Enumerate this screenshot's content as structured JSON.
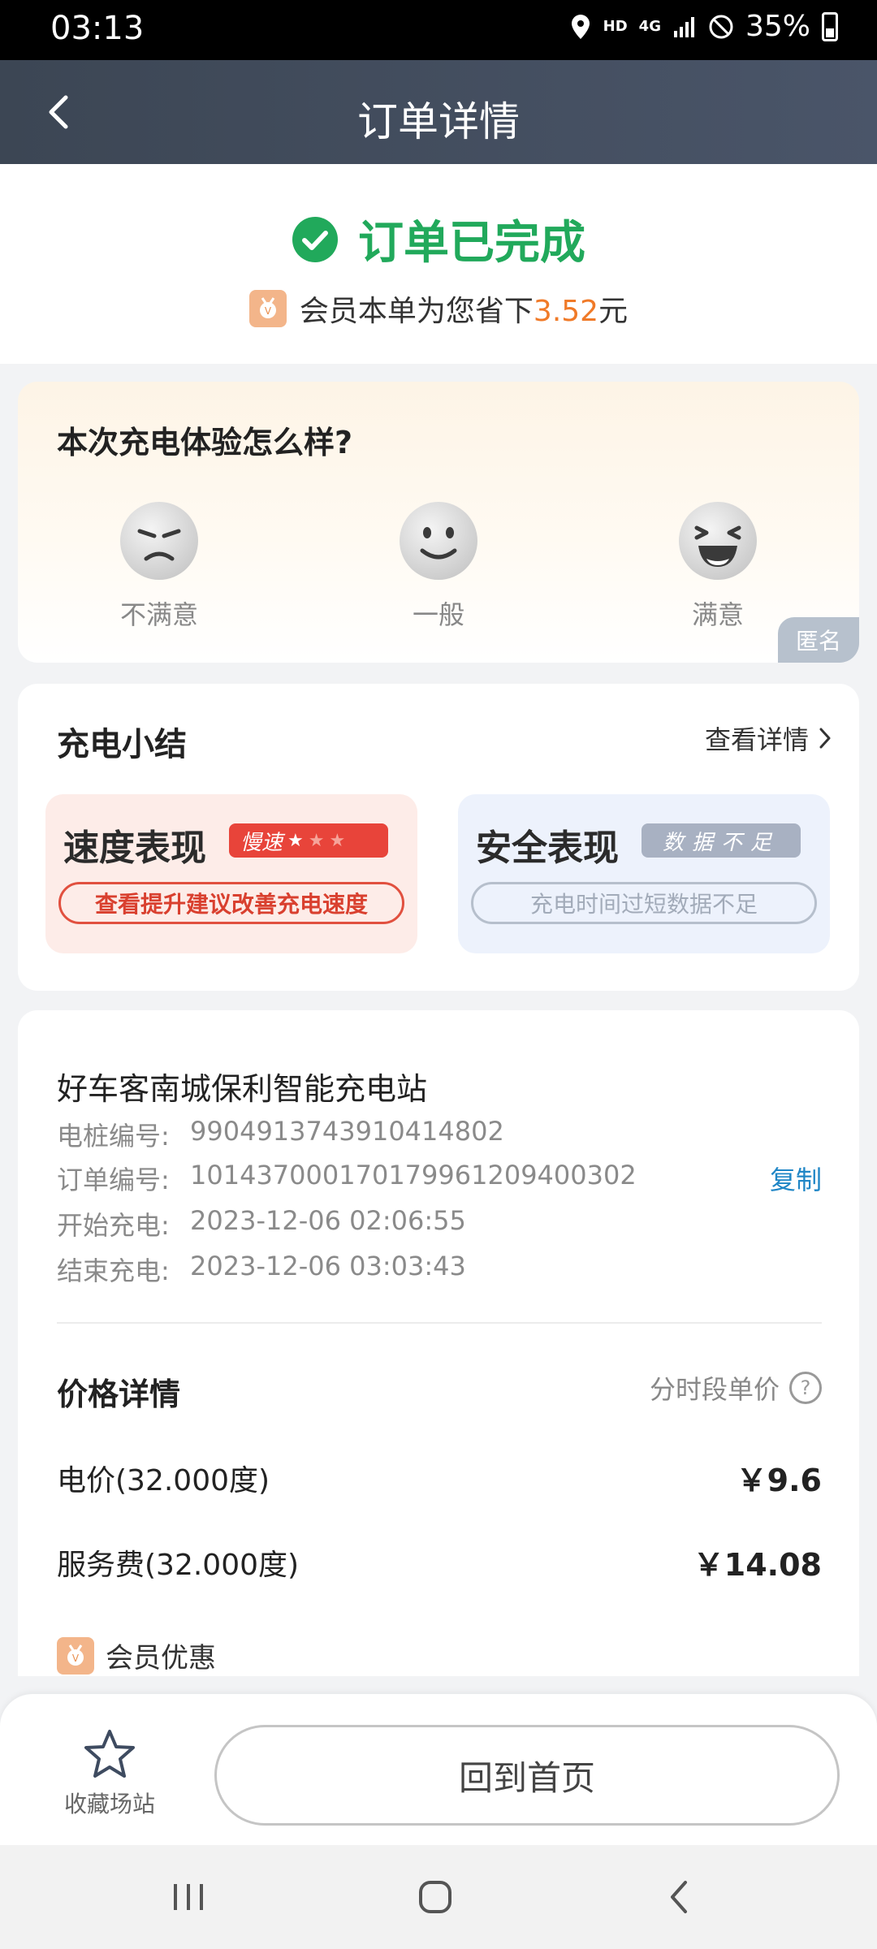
{
  "status_bar": {
    "time": "03:13",
    "network_hd": "HD",
    "network_4g": "4G",
    "battery": "35%"
  },
  "nav": {
    "title": "订单详情"
  },
  "order_status": {
    "title": "订单已完成",
    "saving_prefix": "会员本单为您省下",
    "saving_amount": "3.52",
    "saving_suffix": "元",
    "colors": {
      "success": "#21a95b",
      "highlight": "#f07a28"
    }
  },
  "rating": {
    "question": "本次充电体验怎么样?",
    "options": [
      {
        "label": "不满意",
        "icon": "angry-face-icon"
      },
      {
        "label": "一般",
        "icon": "neutral-face-icon"
      },
      {
        "label": "满意",
        "icon": "laughing-face-icon"
      }
    ],
    "anonymous_tag": "匿名"
  },
  "summary": {
    "title": "充电小结",
    "detail_link": "查看详情",
    "speed": {
      "title": "速度表现",
      "badge": "慢速",
      "stars_filled": 1,
      "stars_total": 3,
      "action": "查看提升建议改善充电速度"
    },
    "safety": {
      "title": "安全表现",
      "badge": "数据不足",
      "action": "充电时间过短数据不足"
    }
  },
  "order_info": {
    "station_name": "好车客南城保利智能充电站",
    "pile_label": "电桩编号:",
    "pile_value": "990491374391041480​2",
    "order_label": "订单编号:",
    "order_value": "10143700017017996120940030​2",
    "copy_label": "复制",
    "start_label": "开始充电:",
    "start_value": "2023-12-06 02:06:55",
    "end_label": "结束充电:",
    "end_value": "2023-12-06 03:03:43"
  },
  "price": {
    "title": "价格详情",
    "hint": "分时段单价",
    "electricity_label": "电价(32.000度)",
    "electricity_value": "￥9.6",
    "service_label": "服务费(32.000度)",
    "service_value": "￥14.08",
    "member_discount_label": "会员优惠"
  },
  "bottom": {
    "favorite_label": "收藏场站",
    "home_button": "回到首页"
  }
}
